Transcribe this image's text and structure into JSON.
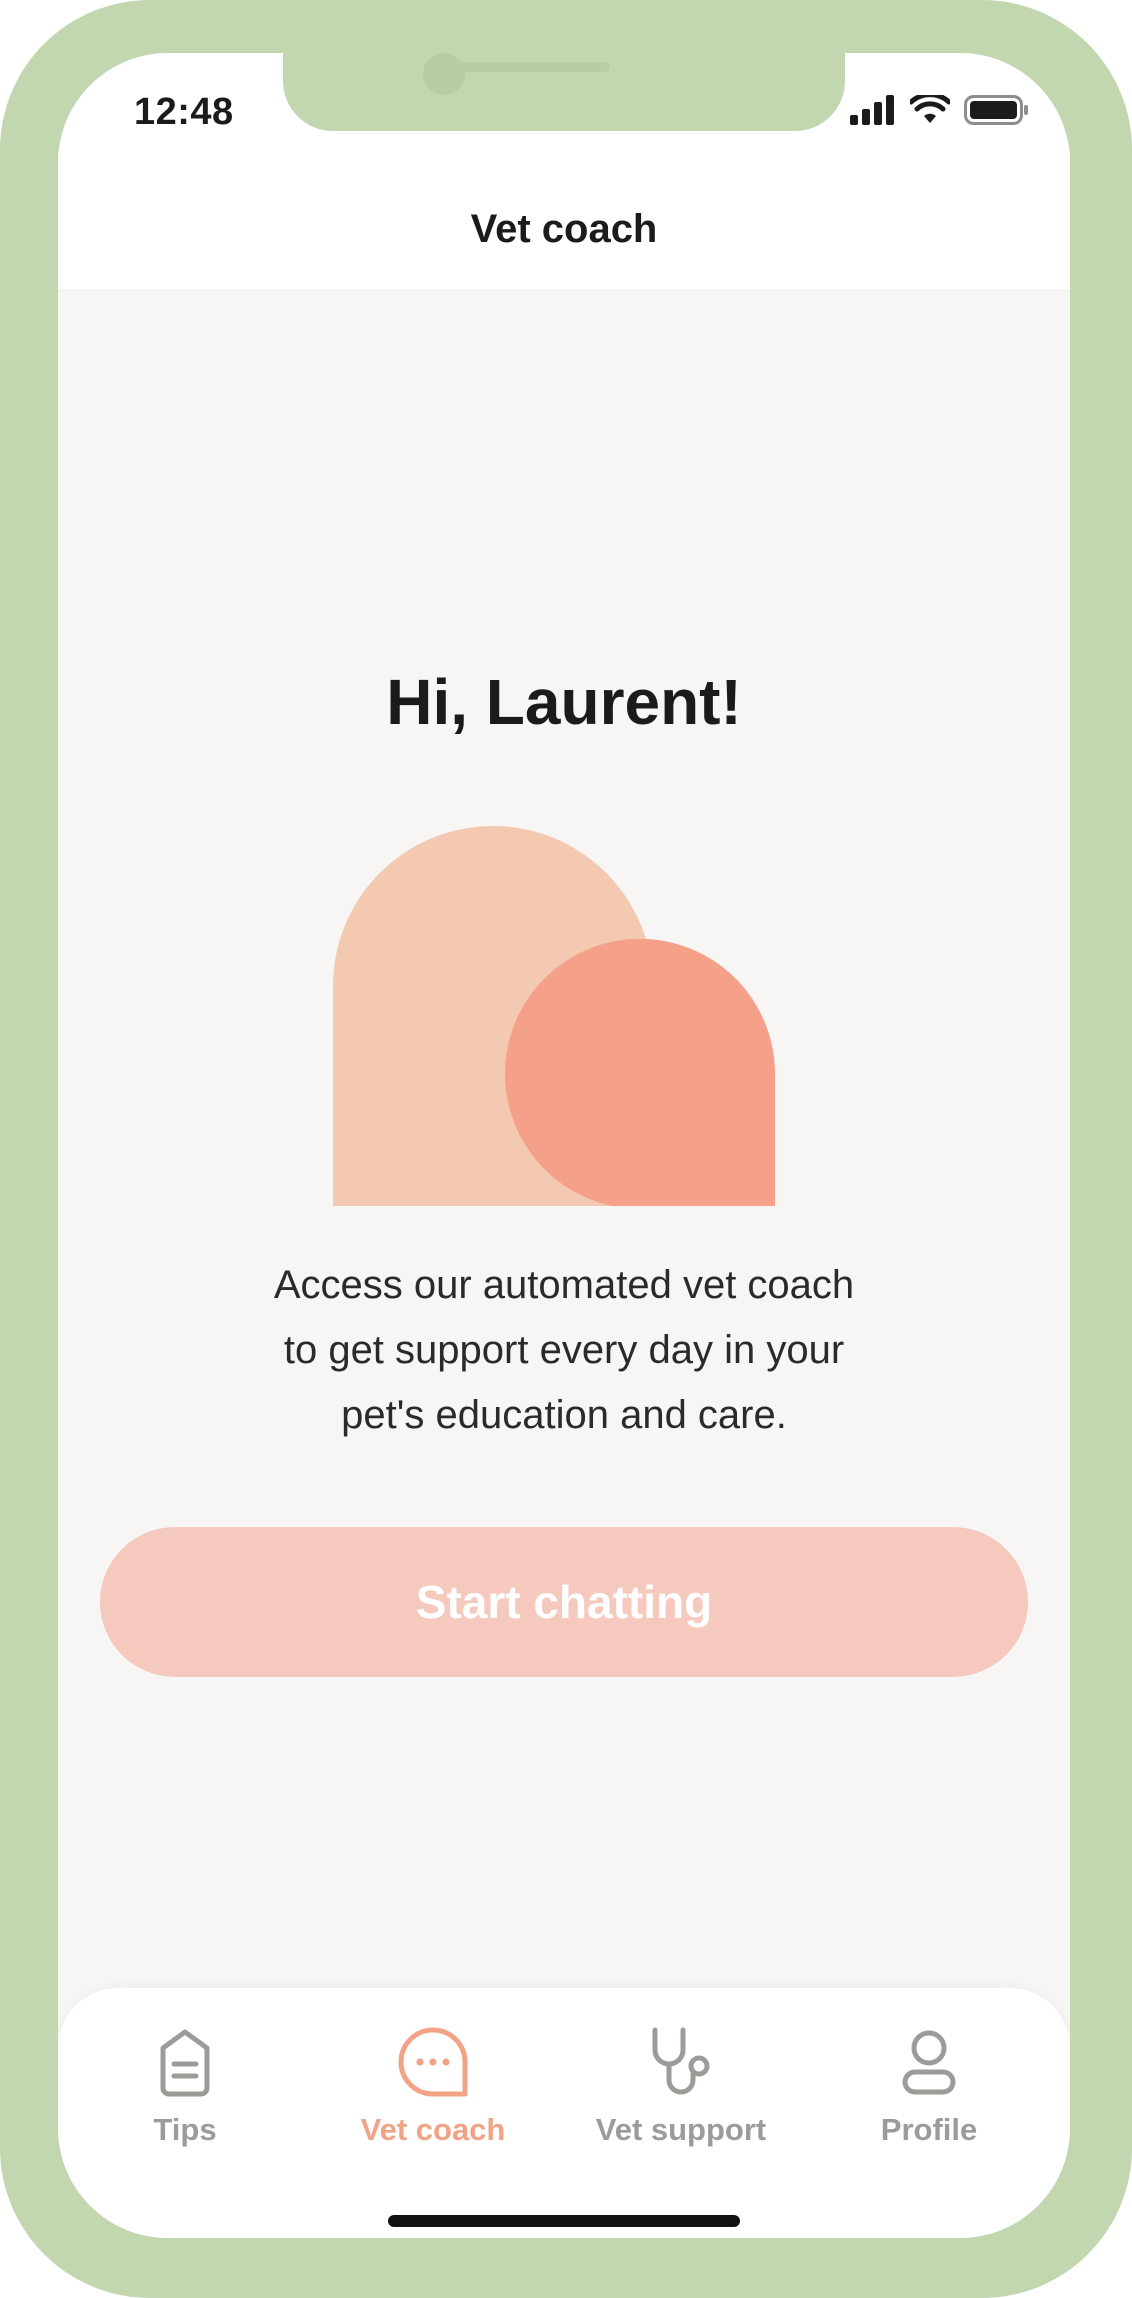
{
  "status_bar": {
    "time": "12:48",
    "icons": [
      "cellular-signal-icon",
      "wifi-icon",
      "battery-icon"
    ]
  },
  "header": {
    "title": "Vet coach"
  },
  "main": {
    "greeting": "Hi, Laurent!",
    "illustration_icon": "chat-bubbles-illustration",
    "description_lines": [
      "Access our automated vet coach",
      "to get support every day in your",
      "pet's education and care."
    ],
    "cta_label": "Start chatting"
  },
  "tabbar": {
    "active_index": 1,
    "items": [
      {
        "label": "Tips",
        "icon": "tips-document-icon"
      },
      {
        "label": "Vet coach",
        "icon": "chat-bubble-icon"
      },
      {
        "label": "Vet support",
        "icon": "stethoscope-icon"
      },
      {
        "label": "Profile",
        "icon": "profile-icon"
      }
    ]
  },
  "colors": {
    "frame": "#c2d6b0",
    "background": "#f7f6f5",
    "accent": "#f2a386",
    "bubble_light": "#f4c9b2",
    "bubble_dark": "#f5a089",
    "cta_background": "#f5c9be",
    "tab_inactive": "#9d9b98",
    "text_primary": "#1b1b1b"
  }
}
